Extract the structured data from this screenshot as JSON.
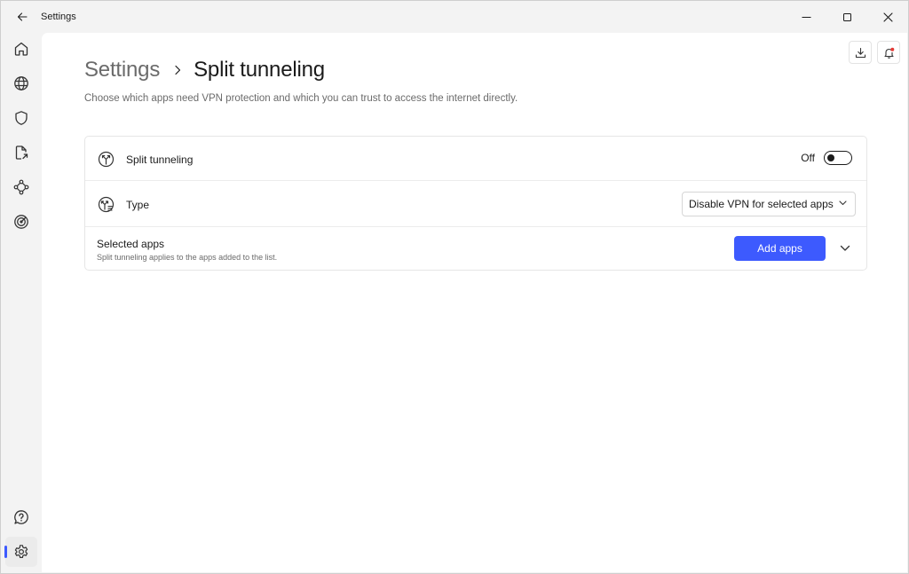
{
  "window": {
    "title": "Settings",
    "icons": {
      "back": "arrow-left-icon",
      "minimize": "minimize-icon",
      "maximize": "maximize-icon",
      "close": "close-icon"
    }
  },
  "sidebar": {
    "items": [
      {
        "name": "home",
        "icon": "home-icon"
      },
      {
        "name": "globe",
        "icon": "globe-icon"
      },
      {
        "name": "shield",
        "icon": "shield-icon"
      },
      {
        "name": "file-share",
        "icon": "file-share-icon"
      },
      {
        "name": "mesh",
        "icon": "mesh-network-icon"
      },
      {
        "name": "target",
        "icon": "target-icon"
      },
      {
        "name": "help",
        "icon": "help-icon"
      },
      {
        "name": "settings",
        "icon": "gear-icon",
        "active": true
      }
    ],
    "accent_color": "#3d5afe"
  },
  "header_actions": {
    "icons": [
      "download-icon",
      "notification-bell-icon"
    ],
    "notification_dot_color": "#e53935"
  },
  "breadcrumb": {
    "parent": "Settings",
    "current": "Split tunneling"
  },
  "description": "Choose which apps need VPN protection and which you can trust to access the internet directly.",
  "settings": {
    "split_tunneling": {
      "label": "Split tunneling",
      "state_text": "Off",
      "enabled": false
    },
    "type": {
      "label": "Type",
      "selected": "Disable VPN for selected apps"
    },
    "selected_apps": {
      "title": "Selected apps",
      "subtitle": "Split tunneling applies to the apps added to the list.",
      "add_button": "Add apps"
    }
  },
  "colors": {
    "primary_button": "#3d5afe",
    "content_bg": "#ffffff",
    "chrome_bg": "#f3f3f3"
  }
}
